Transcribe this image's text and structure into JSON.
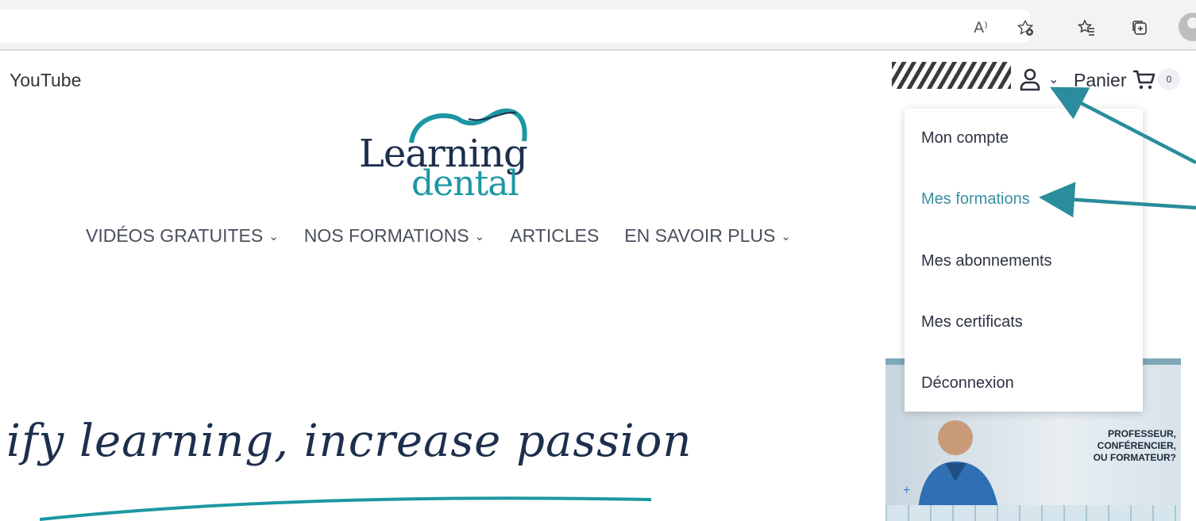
{
  "browser": {
    "icons": [
      "read-aloud-icon",
      "add-favorite-icon",
      "favorites-icon",
      "collections-icon",
      "profile-avatar"
    ],
    "read_aloud_glyph": "A⁾"
  },
  "header": {
    "top_link": "YouTube",
    "cart_label": "Panier",
    "cart_count": "0"
  },
  "logo": {
    "line1": "Learning",
    "line2": "dental"
  },
  "nav": {
    "items": [
      {
        "label": "VIDÉOS GRATUITES",
        "has_dropdown": true
      },
      {
        "label": "NOS FORMATIONS",
        "has_dropdown": true
      },
      {
        "label": "ARTICLES",
        "has_dropdown": false
      },
      {
        "label": "EN SAVOIR PLUS",
        "has_dropdown": true
      }
    ]
  },
  "user_menu": {
    "items": [
      {
        "label": "Mon compte",
        "active": false
      },
      {
        "label": "Mes formations",
        "active": true
      },
      {
        "label": "Mes abonnements",
        "active": false
      },
      {
        "label": "Mes certificats",
        "active": false
      },
      {
        "label": "Déconnexion",
        "active": false
      }
    ]
  },
  "banner": {
    "line1": "PROFESSEUR, CONFÉRENCIER,",
    "line2": "OU FORMATEUR?"
  },
  "slogan": "ify learning, increase passion",
  "colors": {
    "accent": "#3b8fa3",
    "arrow": "#2a8c9c",
    "navy": "#1d2f4d"
  }
}
